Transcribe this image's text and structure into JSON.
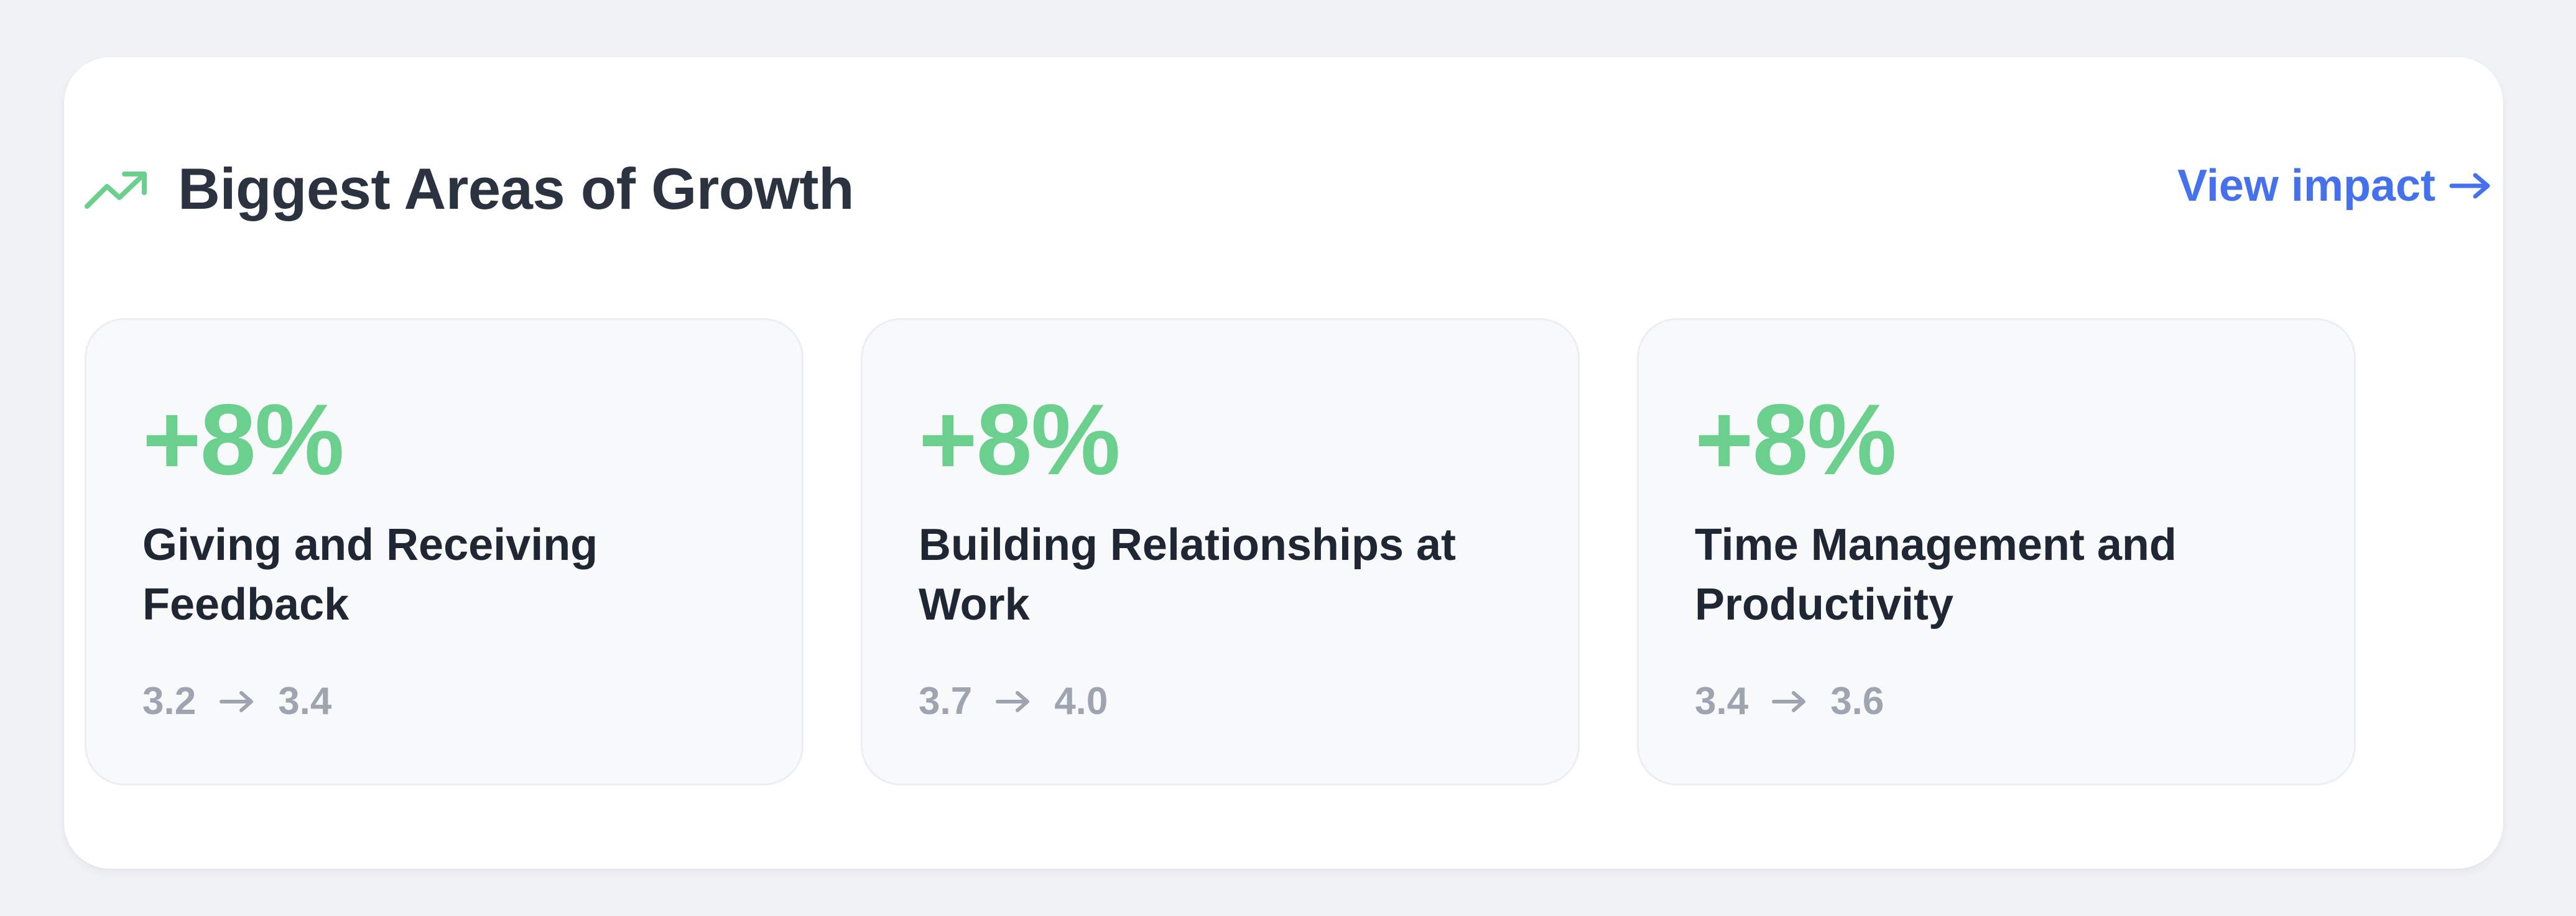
{
  "header": {
    "icon": "trending-up-icon",
    "title": "Biggest Areas of Growth",
    "link_label": "View impact",
    "link_icon": "arrow-right-icon"
  },
  "cards": [
    {
      "change": "+8%",
      "name": "Giving and Receiving Feedback",
      "from": "3.2",
      "to": "3.4"
    },
    {
      "change": "+8%",
      "name": "Building Relationships at Work",
      "from": "3.7",
      "to": "4.0"
    },
    {
      "change": "+8%",
      "name": "Time Management and Productivity",
      "from": "3.4",
      "to": "3.6"
    }
  ],
  "colors": {
    "page_bg": "#f1f2f5",
    "panel_bg": "#ffffff",
    "card_bg": "#f8f9fb",
    "title": "#2c3340",
    "accent_green": "#6bd08e",
    "link_blue": "#4671ee",
    "muted": "#9ea5b0"
  }
}
